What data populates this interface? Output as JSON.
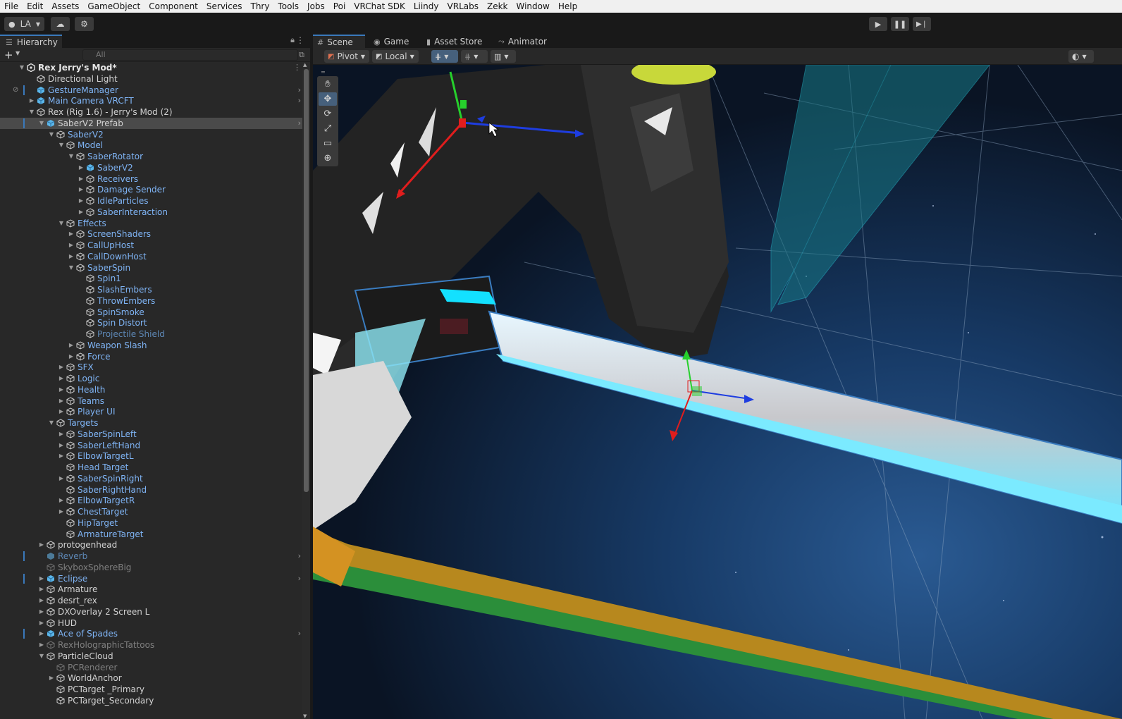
{
  "menubar": [
    "File",
    "Edit",
    "Assets",
    "GameObject",
    "Component",
    "Services",
    "Thry",
    "Tools",
    "Jobs",
    "Poi",
    "VRChat SDK",
    "Liindy",
    "VRLabs",
    "Zekk",
    "Window",
    "Help"
  ],
  "toolbar": {
    "account_label": "LA"
  },
  "hierarchy": {
    "tab_label": "Hierarchy",
    "search_placeholder": "All",
    "rows": [
      {
        "label": "Rex Jerry's Mod*",
        "depth": 0,
        "arrow": "down",
        "icon": "unity",
        "color": "bold",
        "menu": true
      },
      {
        "label": "Directional Light",
        "depth": 1,
        "arrow": "",
        "icon": "cube",
        "color": "white"
      },
      {
        "label": "GestureManager",
        "depth": 1,
        "arrow": "",
        "icon": "prefab",
        "color": "blue",
        "more": true,
        "mark": true,
        "vis": true
      },
      {
        "label": "Main Camera VRCFT",
        "depth": 1,
        "arrow": "right",
        "icon": "prefab",
        "color": "blue",
        "more": true
      },
      {
        "label": "Rex (Rig 1.6) - Jerry's Mod (2)",
        "depth": 1,
        "arrow": "down",
        "icon": "cube",
        "color": "white"
      },
      {
        "label": "SaberV2 Prefab",
        "depth": 2,
        "arrow": "down",
        "icon": "prefab",
        "color": "white",
        "more": true,
        "sel": true,
        "mark": true
      },
      {
        "label": "SaberV2",
        "depth": 3,
        "arrow": "down",
        "icon": "cube",
        "color": "blue"
      },
      {
        "label": "Model",
        "depth": 4,
        "arrow": "down",
        "icon": "cube",
        "color": "blue"
      },
      {
        "label": "SaberRotator",
        "depth": 5,
        "arrow": "down",
        "icon": "cube",
        "color": "blue"
      },
      {
        "label": "SaberV2",
        "depth": 6,
        "arrow": "right",
        "icon": "prefab",
        "color": "blue"
      },
      {
        "label": "Receivers",
        "depth": 6,
        "arrow": "right",
        "icon": "cube",
        "color": "blue"
      },
      {
        "label": "Damage Sender",
        "depth": 6,
        "arrow": "right",
        "icon": "cube",
        "color": "blue"
      },
      {
        "label": "IdleParticles",
        "depth": 6,
        "arrow": "right",
        "icon": "cube",
        "color": "blue"
      },
      {
        "label": "SaberInteraction",
        "depth": 6,
        "arrow": "right",
        "icon": "cube",
        "color": "blue"
      },
      {
        "label": "Effects",
        "depth": 4,
        "arrow": "down",
        "icon": "cube",
        "color": "blue"
      },
      {
        "label": "ScreenShaders",
        "depth": 5,
        "arrow": "right",
        "icon": "cube",
        "color": "blue"
      },
      {
        "label": "CallUpHost",
        "depth": 5,
        "arrow": "right",
        "icon": "cube",
        "color": "blue"
      },
      {
        "label": "CallDownHost",
        "depth": 5,
        "arrow": "right",
        "icon": "cube",
        "color": "blue"
      },
      {
        "label": "SaberSpin",
        "depth": 5,
        "arrow": "down",
        "icon": "cube",
        "color": "blue"
      },
      {
        "label": "Spin1",
        "depth": 6,
        "arrow": "",
        "icon": "cube",
        "color": "blue"
      },
      {
        "label": "SlashEmbers",
        "depth": 6,
        "arrow": "",
        "icon": "cube",
        "color": "blue"
      },
      {
        "label": "ThrowEmbers",
        "depth": 6,
        "arrow": "",
        "icon": "cube",
        "color": "blue"
      },
      {
        "label": "SpinSmoke",
        "depth": 6,
        "arrow": "",
        "icon": "cube",
        "color": "blue"
      },
      {
        "label": "Spin Distort",
        "depth": 6,
        "arrow": "",
        "icon": "cube",
        "color": "blue"
      },
      {
        "label": "Projectile Shield",
        "depth": 6,
        "arrow": "",
        "icon": "cube",
        "color": "dblue"
      },
      {
        "label": "Weapon Slash",
        "depth": 5,
        "arrow": "right",
        "icon": "cube",
        "color": "blue"
      },
      {
        "label": "Force",
        "depth": 5,
        "arrow": "right",
        "icon": "cube",
        "color": "blue"
      },
      {
        "label": "SFX",
        "depth": 4,
        "arrow": "right",
        "icon": "cube",
        "color": "blue"
      },
      {
        "label": "Logic",
        "depth": 4,
        "arrow": "right",
        "icon": "cube",
        "color": "blue"
      },
      {
        "label": "Health",
        "depth": 4,
        "arrow": "right",
        "icon": "cube",
        "color": "blue"
      },
      {
        "label": "Teams",
        "depth": 4,
        "arrow": "right",
        "icon": "cube",
        "color": "blue"
      },
      {
        "label": "Player UI",
        "depth": 4,
        "arrow": "right",
        "icon": "cube",
        "color": "blue"
      },
      {
        "label": "Targets",
        "depth": 3,
        "arrow": "down",
        "icon": "cube",
        "color": "blue"
      },
      {
        "label": "SaberSpinLeft",
        "depth": 4,
        "arrow": "right",
        "icon": "cube",
        "color": "blue"
      },
      {
        "label": "SaberLeftHand",
        "depth": 4,
        "arrow": "right",
        "icon": "cube",
        "color": "blue"
      },
      {
        "label": "ElbowTargetL",
        "depth": 4,
        "arrow": "right",
        "icon": "cube",
        "color": "blue"
      },
      {
        "label": "Head Target",
        "depth": 4,
        "arrow": "",
        "icon": "cube",
        "color": "blue"
      },
      {
        "label": "SaberSpinRight",
        "depth": 4,
        "arrow": "right",
        "icon": "cube",
        "color": "blue"
      },
      {
        "label": "SaberRightHand",
        "depth": 4,
        "arrow": "",
        "icon": "cube",
        "color": "blue"
      },
      {
        "label": "ElbowTargetR",
        "depth": 4,
        "arrow": "right",
        "icon": "cube",
        "color": "blue"
      },
      {
        "label": "ChestTarget",
        "depth": 4,
        "arrow": "right",
        "icon": "cube",
        "color": "blue"
      },
      {
        "label": "HipTarget",
        "depth": 4,
        "arrow": "",
        "icon": "cube",
        "color": "blue"
      },
      {
        "label": "ArmatureTarget",
        "depth": 4,
        "arrow": "",
        "icon": "cube",
        "color": "blue"
      },
      {
        "label": "protogenhead",
        "depth": 2,
        "arrow": "right",
        "icon": "cube",
        "color": "white"
      },
      {
        "label": "Reverb",
        "depth": 2,
        "arrow": "",
        "icon": "prefab-dim",
        "color": "dblue",
        "more": true,
        "mark": true
      },
      {
        "label": "SkyboxSphereBig",
        "depth": 2,
        "arrow": "",
        "icon": "cube-dim",
        "color": "gray"
      },
      {
        "label": "Eclipse",
        "depth": 2,
        "arrow": "right",
        "icon": "prefab",
        "color": "blue",
        "more": true,
        "mark": true
      },
      {
        "label": "Armature",
        "depth": 2,
        "arrow": "right",
        "icon": "cube",
        "color": "white"
      },
      {
        "label": "desrt_rex",
        "depth": 2,
        "arrow": "right",
        "icon": "cube",
        "color": "white"
      },
      {
        "label": "DXOverlay 2 Screen L",
        "depth": 2,
        "arrow": "right",
        "icon": "cube",
        "color": "white"
      },
      {
        "label": "HUD",
        "depth": 2,
        "arrow": "right",
        "icon": "cube",
        "color": "white"
      },
      {
        "label": "Ace of Spades",
        "depth": 2,
        "arrow": "right",
        "icon": "prefab",
        "color": "blue",
        "more": true,
        "mark": true
      },
      {
        "label": "RexHolographicTattoos",
        "depth": 2,
        "arrow": "right",
        "icon": "cube-dim",
        "color": "gray"
      },
      {
        "label": "ParticleCloud",
        "depth": 2,
        "arrow": "down",
        "icon": "cube",
        "color": "white"
      },
      {
        "label": "PCRenderer",
        "depth": 3,
        "arrow": "",
        "icon": "cube-dim",
        "color": "gray"
      },
      {
        "label": "WorldAnchor",
        "depth": 3,
        "arrow": "right",
        "icon": "cube",
        "color": "white"
      },
      {
        "label": "PCTarget _Primary",
        "depth": 3,
        "arrow": "",
        "icon": "cube",
        "color": "white"
      },
      {
        "label": "PCTarget_Secondary",
        "depth": 3,
        "arrow": "",
        "icon": "cube",
        "color": "white"
      }
    ]
  },
  "scene": {
    "tabs": [
      {
        "label": "Scene",
        "icon": "#",
        "active": true
      },
      {
        "label": "Game",
        "icon": "◉",
        "active": false
      },
      {
        "label": "Asset Store",
        "icon": "▮",
        "active": false
      },
      {
        "label": "Animator",
        "icon": "⤳",
        "active": false
      }
    ],
    "pivot_label": "Pivot",
    "local_label": "Local",
    "tools": [
      "hand",
      "move",
      "rotate",
      "scale",
      "rect",
      "transform"
    ],
    "active_tool": "move"
  }
}
